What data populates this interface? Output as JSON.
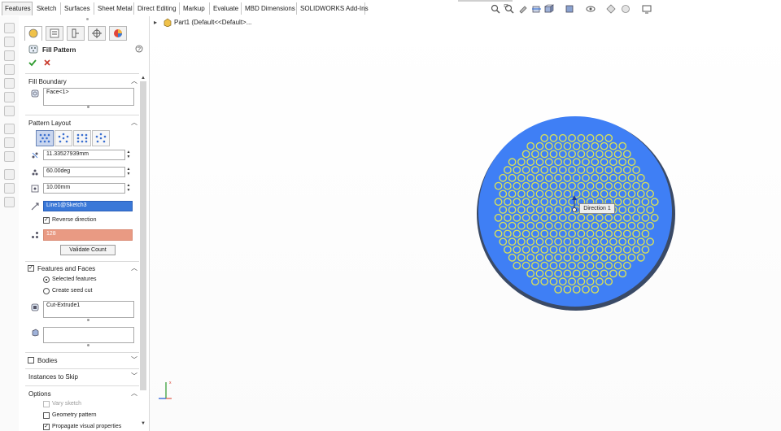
{
  "tabs": [
    "Features",
    "Sketch",
    "Surfaces",
    "Sheet Metal",
    "Direct Editing",
    "Markup",
    "Evaluate",
    "MBD Dimensions",
    "SOLIDWORKS Add-Ins"
  ],
  "active_tab": "Features",
  "tree": {
    "part": "Part1  (Default<<Default>..."
  },
  "pm": {
    "title": "Fill Pattern",
    "fill_boundary": {
      "title": "Fill Boundary",
      "value": "Face<1>"
    },
    "pattern_layout": {
      "title": "Pattern Layout",
      "spacing": "11.33527939mm",
      "angle": "60.00deg",
      "margin": "10.00mm",
      "direction": "Line1@Sketch3",
      "reverse_label": "Reverse direction",
      "reverse_checked": true,
      "count": "128",
      "validate_label": "Validate Count"
    },
    "features_faces": {
      "title": "Features and Faces",
      "selected_label": "Selected features",
      "seed_label": "Create seed cut",
      "feature": "Cut-Extrude1"
    },
    "bodies": {
      "title": "Bodies"
    },
    "instances": {
      "title": "Instances to Skip"
    },
    "options": {
      "title": "Options",
      "vary_label": "Vary sketch",
      "geometry_label": "Geometry pattern",
      "propagate_label": "Propagate visual properties"
    }
  },
  "callout": {
    "label": "Direction 1"
  },
  "colors": {
    "face": "#3f7ff5",
    "rim": "#3a4a66",
    "holes": "#d7e05a",
    "direction_field": "#3a78d8",
    "count_field": "#e99a83"
  },
  "icons": [
    "zoom-to-fit-icon",
    "zoom-area-icon",
    "previous-view-icon",
    "section-view-icon",
    "view-orientation-icon",
    "display-style-icon",
    "hide-show-icon",
    "edit-appearance-icon",
    "scene-icon",
    "view-settings-icon"
  ]
}
